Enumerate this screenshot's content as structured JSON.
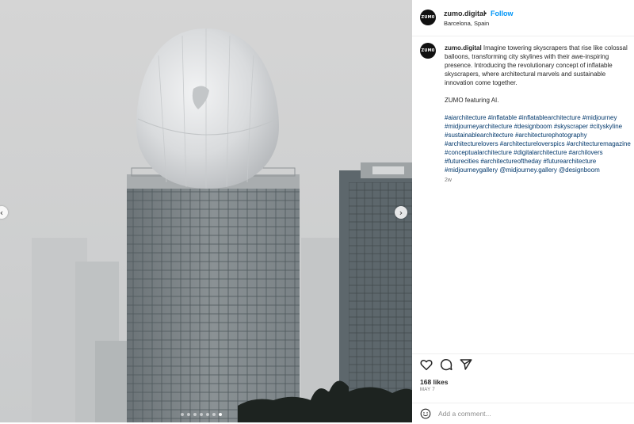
{
  "post": {
    "username": "zumo.digital",
    "avatar_text": "ZUM0",
    "separator": "•",
    "follow_label": "Follow",
    "location": "Barcelona, Spain",
    "caption_lines": [
      "Imagine towering skyscrapers that rise like colossal",
      "balloons, transforming city skylines with their awe-inspiring",
      "presence. Introducing the revolutionary concept of inflatable",
      "skyscrapers, where architectural marvels and sustainable",
      "innovation come together."
    ],
    "caption_extra": "ZUMO featuring AI.",
    "hashtag_lines": [
      "#aiarchitecture #inflatable #inflatablearchitecture #midjourney",
      "#midjourneyarchitecture #designboom #skyscraper #cityskyline",
      "#sustainablearchitecture #architecturephotography",
      "#architecturelovers #architectureloverspics #architecturemagazine",
      "#conceptualarchitecture #digitalarchitecture #archilovers",
      "#futurecities #architectureoftheday #futurearchitecture",
      "#midjourneygallery @midjourney.gallery @designboom"
    ],
    "time_ago": "2w",
    "likes": "168 likes",
    "date": "MAY 7",
    "comment_placeholder": "Add a comment..."
  },
  "carousel": {
    "prev_icon": "chevron-left-icon",
    "next_icon": "chevron-right-icon",
    "slide_count": 7,
    "active_slide": 7
  },
  "icons": [
    "heart-icon",
    "comment-icon",
    "share-icon",
    "emoji-icon"
  ],
  "colors": {
    "follow": "#0095f6",
    "hashtag": "#00376b",
    "muted": "#737373",
    "fog": "#d9d9d9"
  }
}
